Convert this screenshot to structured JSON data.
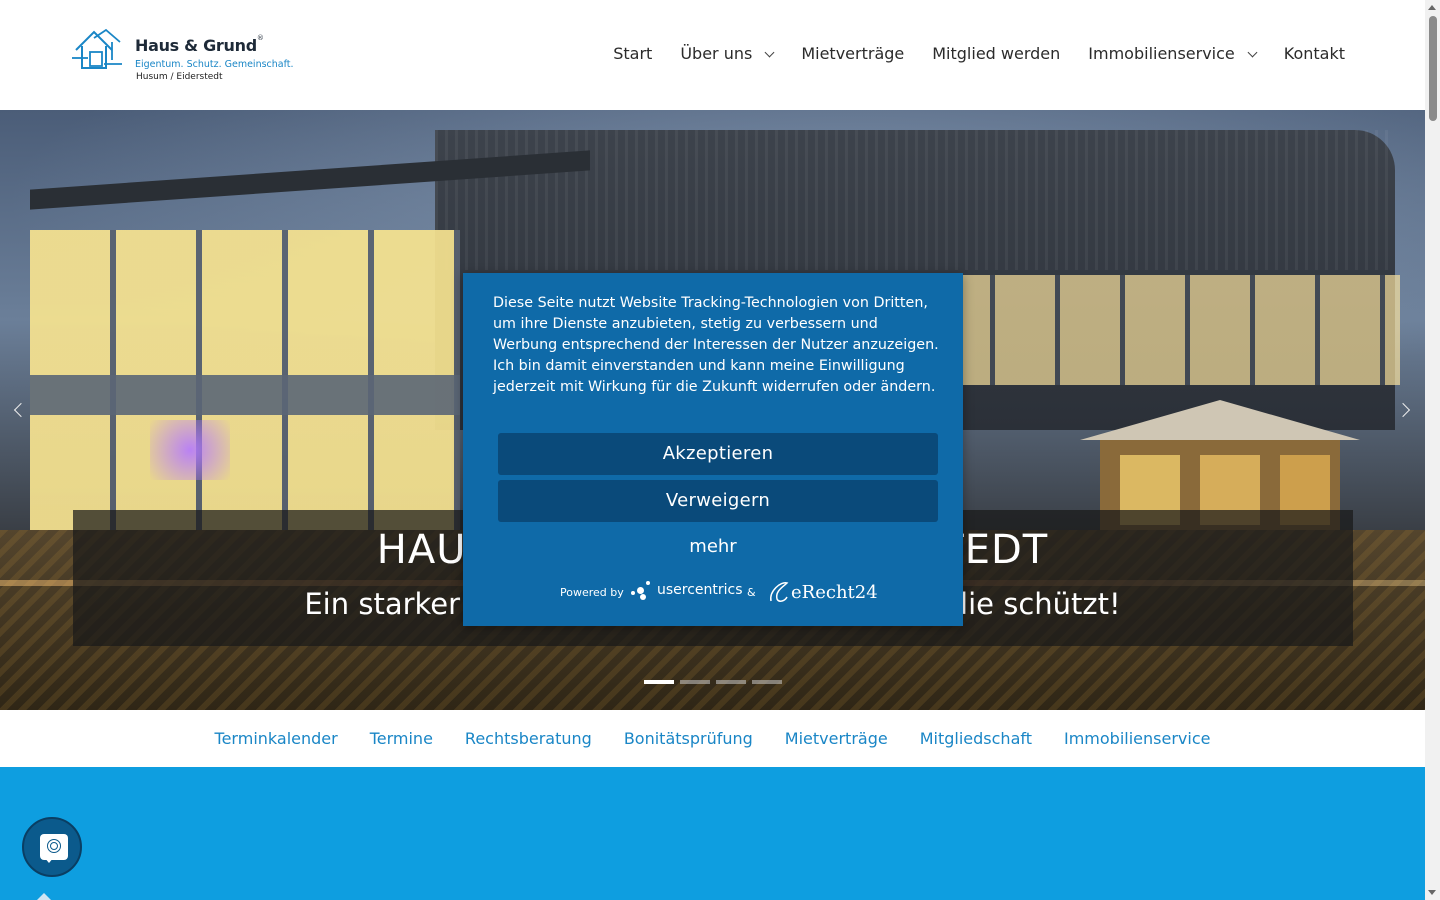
{
  "logo": {
    "name": "Haus & Grund",
    "registered": "®",
    "tagline": "Eigentum. Schutz. Gemeinschaft.",
    "location": "Husum / Eiderstedt",
    "color_primary": "#1a86c6"
  },
  "nav": {
    "items": [
      {
        "label": "Start",
        "dropdown": false
      },
      {
        "label": "Über uns",
        "dropdown": true
      },
      {
        "label": "Mietverträge",
        "dropdown": false
      },
      {
        "label": "Mitglied werden",
        "dropdown": false
      },
      {
        "label": "Immobilienservice",
        "dropdown": true
      },
      {
        "label": "Kontakt",
        "dropdown": false
      }
    ]
  },
  "hero": {
    "title_left": "HAUS",
    "title_right": "STEDT",
    "subtitle_left": "Ein starker",
    "subtitle_right": "lie schützt!",
    "slide_count": 4,
    "active_slide": 1
  },
  "quick_links": [
    "Terminkalender",
    "Termine",
    "Rechtsberatung",
    "Bonitätsprüfung",
    "Mietverträge",
    "Mitgliedschaft",
    "Immobilienservice"
  ],
  "consent": {
    "text": "Diese Seite nutzt Website Tracking-Technologien von Dritten, um ihre Dienste anzubieten, stetig zu verbessern und Werbung entsprechend der Interessen der Nutzer anzuzeigen. Ich bin damit einverstanden und kann meine Einwilligung jederzeit mit Wirkung für die Zukunft widerrufen oder ändern.",
    "accept_label": "Akzeptieren",
    "deny_label": "Verweigern",
    "more_label": "mehr",
    "powered_by": "Powered by",
    "provider": "usercentrics",
    "ampersand": "&",
    "partner": "eRecht24",
    "bg_color": "#0f6aa8",
    "button_color": "#0a4a7a"
  },
  "icons": {
    "chat": "fingerprint-chat-icon",
    "prev": "chevron-left-icon",
    "next": "chevron-right-icon"
  },
  "colors": {
    "section_blue": "#0e9ee0",
    "link_blue": "#1a86c6"
  }
}
